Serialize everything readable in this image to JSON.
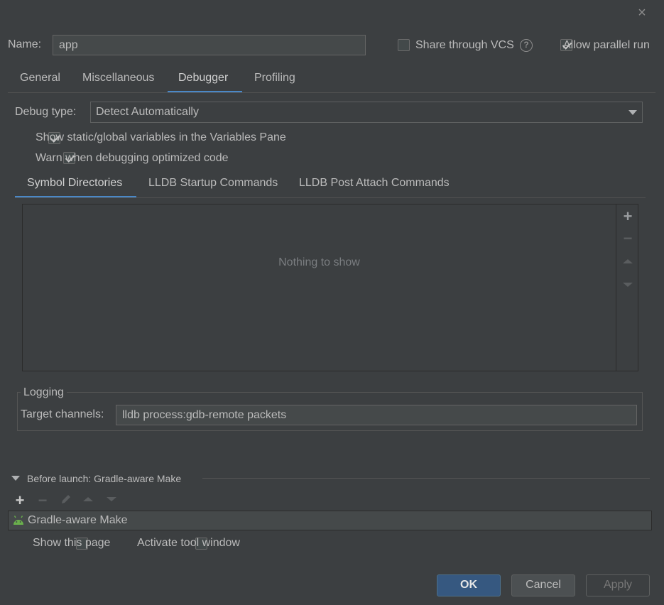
{
  "header": {
    "name_label": "Name:",
    "name_value": "app",
    "share_vcs_label": "Share through VCS",
    "allow_parallel_label": "Allow parallel run"
  },
  "tabs": [
    "General",
    "Miscellaneous",
    "Debugger",
    "Profiling"
  ],
  "active_tab": "Debugger",
  "debugger": {
    "debug_type_label": "Debug type:",
    "debug_type_value": "Detect Automatically",
    "show_static_label": "Show static/global variables in the Variables Pane",
    "warn_optimized_label": "Warn when debugging optimized code",
    "subtabs": [
      "Symbol Directories",
      "LLDB Startup Commands",
      "LLDB Post Attach Commands"
    ],
    "active_subtab": "Symbol Directories",
    "empty_text": "Nothing to show",
    "toolbar": {
      "add": "+",
      "remove": "−"
    }
  },
  "logging": {
    "title": "Logging",
    "target_label": "Target channels:",
    "target_value": "lldb process:gdb-remote packets"
  },
  "before_launch": {
    "title": "Before launch: Gradle-aware Make",
    "toolbar": {
      "add": "+",
      "remove": "−"
    },
    "items": [
      {
        "label": "Gradle-aware Make",
        "icon": "android-icon"
      }
    ],
    "show_page_label": "Show this page",
    "activate_tool_label": "Activate tool window"
  },
  "buttons": {
    "ok": "OK",
    "cancel": "Cancel",
    "apply": "Apply"
  },
  "icons": {
    "close": "×",
    "help": "?"
  },
  "colors": {
    "accent": "#4a88c7",
    "primary_button": "#365880",
    "android_green": "#6ab04c"
  }
}
